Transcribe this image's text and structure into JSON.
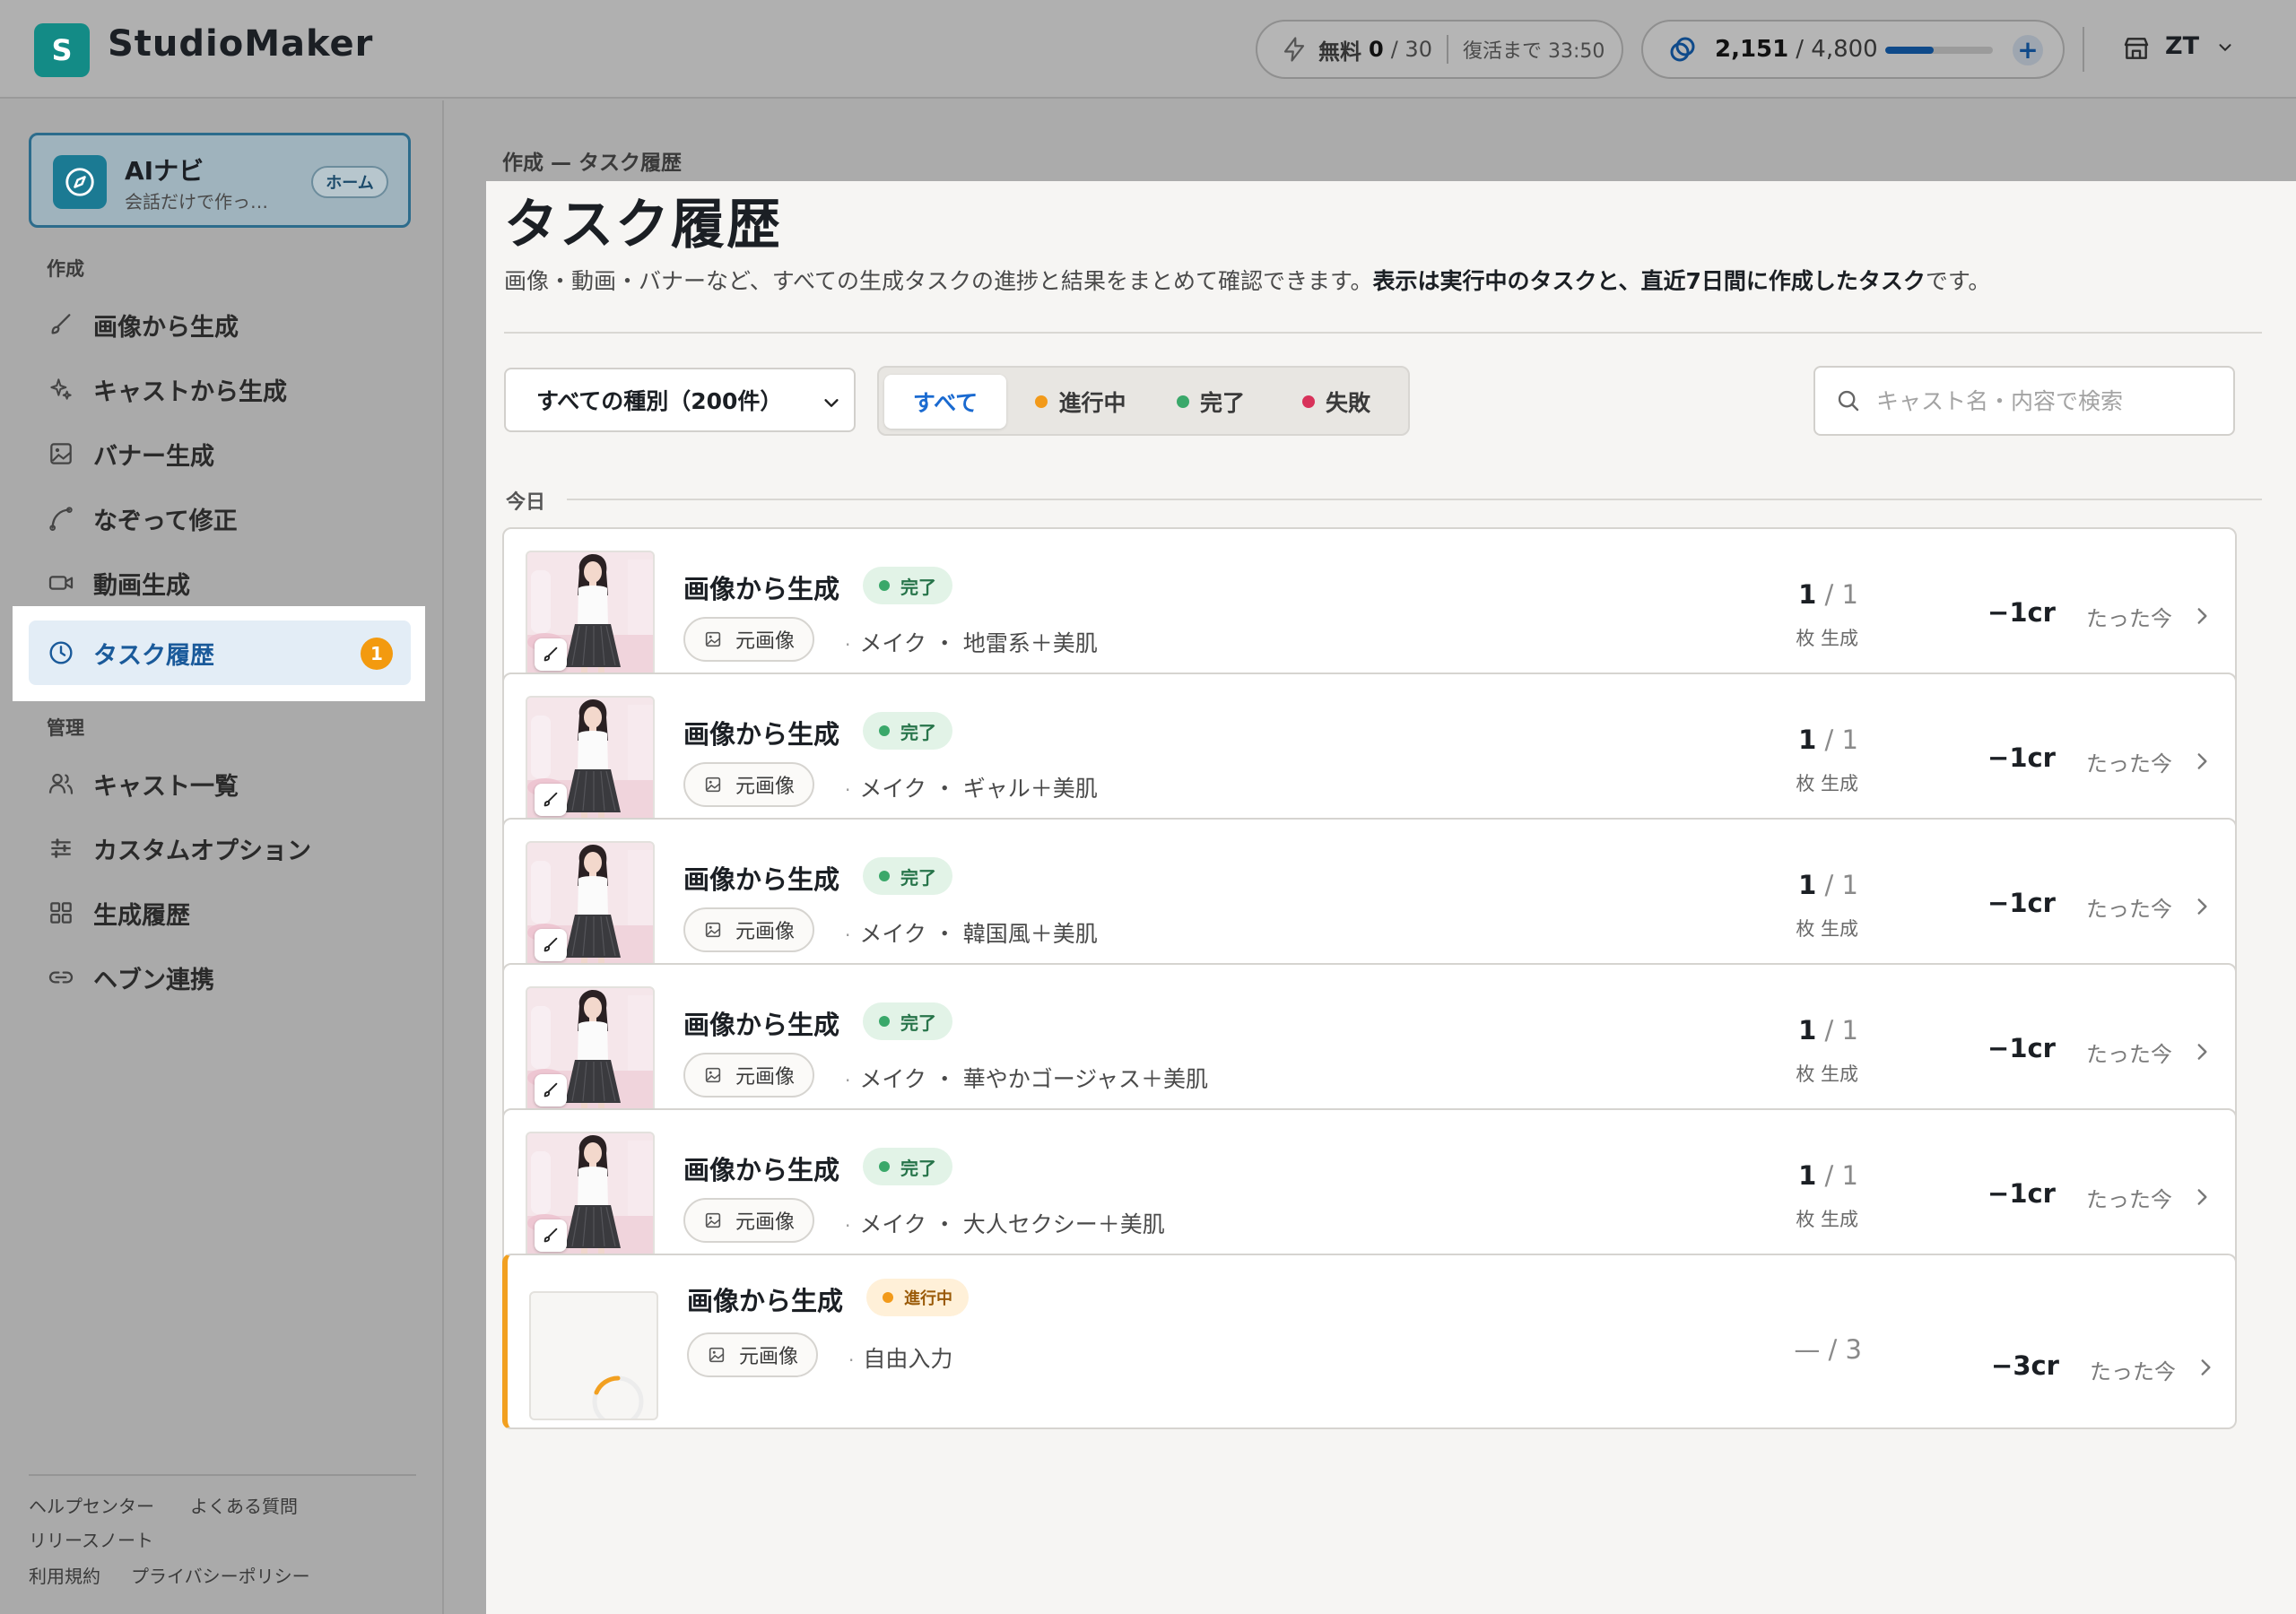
{
  "header": {
    "logo_letter": "S",
    "app_title": "StudioMaker",
    "free": {
      "label": "無料",
      "used": "0",
      "max": "/ 30",
      "recover": "復活まで 33:50"
    },
    "credits": {
      "value": "2,151",
      "max": "/ 4,800",
      "fill_fraction": 0.45,
      "add_label": "+"
    },
    "user": {
      "initials": "ZT"
    }
  },
  "sidebar": {
    "ai_card": {
      "title": "AIナビ",
      "subtitle": "会話だけで作っ…",
      "home_label": "ホーム"
    },
    "section_create": "作成",
    "create_items": [
      {
        "label": "画像から生成",
        "icon": "brush-icon"
      },
      {
        "label": "キャストから生成",
        "icon": "sparkle-icon"
      },
      {
        "label": "バナー生成",
        "icon": "image-icon"
      },
      {
        "label": "なぞって修正",
        "icon": "curve-icon"
      },
      {
        "label": "動画生成",
        "icon": "video-icon"
      },
      {
        "label": "タスク履歴",
        "icon": "clock-icon",
        "badge": "1",
        "active": true
      }
    ],
    "section_manage": "管理",
    "manage_items": [
      {
        "label": "キャスト一覧",
        "icon": "users-icon"
      },
      {
        "label": "カスタムオプション",
        "icon": "sliders-icon"
      },
      {
        "label": "生成履歴",
        "icon": "grid-icon"
      },
      {
        "label": "ヘブン連携",
        "icon": "link-icon"
      }
    ],
    "footer": {
      "help": "ヘルプセンター",
      "faq": "よくある質問",
      "release": "リリースノート",
      "terms": "利用規約",
      "privacy": "プライバシーポリシー"
    }
  },
  "main": {
    "breadcrumb": "作成 — タスク履歴",
    "title": "タスク履歴",
    "desc_plain": "画像・動画・バナーなど、すべての生成タスクの進捗と結果をまとめて確認できます。",
    "desc_bold": "表示は実行中のタスクと、直近7日間に作成したタスク",
    "desc_tail": "です。",
    "type_filter": "すべての種別（200件）",
    "tabs": [
      {
        "label": "すべて",
        "active": true
      },
      {
        "label": "進行中",
        "dot": "#f29a1a"
      },
      {
        "label": "完了",
        "dot": "#3aa86a"
      },
      {
        "label": "失敗",
        "dot": "#d8325a"
      }
    ],
    "search_placeholder": "キャスト名・内容で検索",
    "group_today": "今日",
    "tasks": [
      {
        "title": "画像から生成",
        "status": "完了",
        "status_type": "done",
        "chip": "元画像",
        "meta": "メイク ・ 地雷系＋美肌",
        "generated": "1",
        "total": "/ 1",
        "count_label": "枚 生成",
        "cost": "−1cr",
        "when": "たった今"
      },
      {
        "title": "画像から生成",
        "status": "完了",
        "status_type": "done",
        "chip": "元画像",
        "meta": "メイク ・ ギャル＋美肌",
        "generated": "1",
        "total": "/ 1",
        "count_label": "枚 生成",
        "cost": "−1cr",
        "when": "たった今"
      },
      {
        "title": "画像から生成",
        "status": "完了",
        "status_type": "done",
        "chip": "元画像",
        "meta": "メイク ・ 韓国風＋美肌",
        "generated": "1",
        "total": "/ 1",
        "count_label": "枚 生成",
        "cost": "−1cr",
        "when": "たった今"
      },
      {
        "title": "画像から生成",
        "status": "完了",
        "status_type": "done",
        "chip": "元画像",
        "meta": "メイク ・ 華やかゴージャス＋美肌",
        "generated": "1",
        "total": "/ 1",
        "count_label": "枚 生成",
        "cost": "−1cr",
        "when": "たった今"
      },
      {
        "title": "画像から生成",
        "status": "完了",
        "status_type": "done",
        "chip": "元画像",
        "meta": "メイク ・ 大人セクシー＋美肌",
        "generated": "1",
        "total": "/ 1",
        "count_label": "枚 生成",
        "cost": "−1cr",
        "when": "たった今"
      },
      {
        "title": "画像から生成",
        "status": "進行中",
        "status_type": "running",
        "chip": "元画像",
        "meta": "自由入力",
        "generated": "—",
        "total": "/ 3",
        "count_label": "",
        "cost": "−3cr",
        "when": "たった今"
      }
    ]
  },
  "colors": {
    "accent": "#1a6ad0",
    "brand": "#138b86",
    "badge": "#f39a0f",
    "done_dot": "#3aa86a",
    "running_dot": "#f29a1a",
    "failed_dot": "#d8325a"
  }
}
